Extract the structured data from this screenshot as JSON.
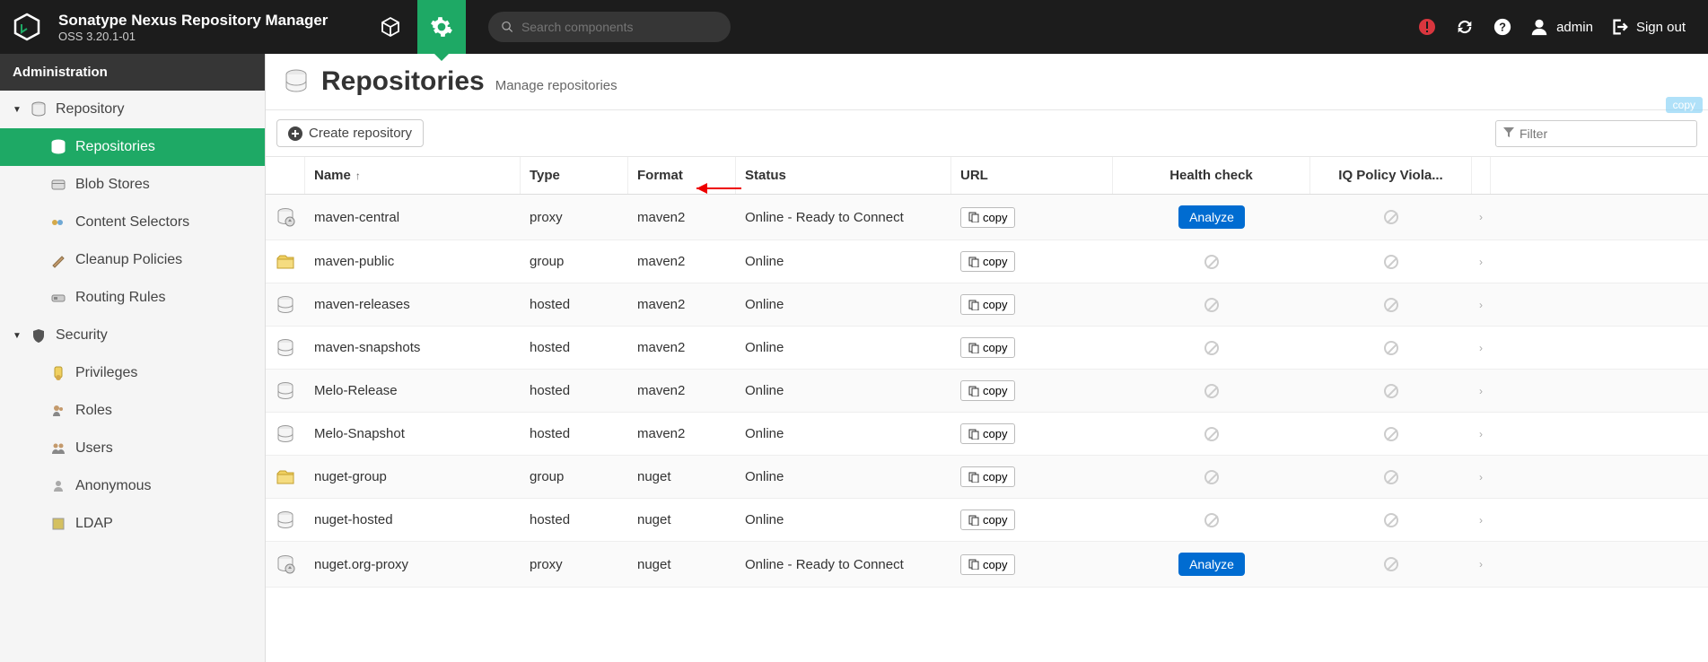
{
  "header": {
    "title": "Sonatype Nexus Repository Manager",
    "version": "OSS 3.20.1-01",
    "search_placeholder": "Search components",
    "username": "admin",
    "signout": "Sign out"
  },
  "sidebar": {
    "title": "Administration",
    "sections": [
      {
        "label": "Repository",
        "expanded": true,
        "items": [
          {
            "label": "Repositories",
            "icon": "db",
            "active": true
          },
          {
            "label": "Blob Stores",
            "icon": "blob"
          },
          {
            "label": "Content Selectors",
            "icon": "tag"
          },
          {
            "label": "Cleanup Policies",
            "icon": "brush"
          },
          {
            "label": "Routing Rules",
            "icon": "route"
          }
        ]
      },
      {
        "label": "Security",
        "expanded": true,
        "items": [
          {
            "label": "Privileges",
            "icon": "badge"
          },
          {
            "label": "Roles",
            "icon": "roles"
          },
          {
            "label": "Users",
            "icon": "users"
          },
          {
            "label": "Anonymous",
            "icon": "anon"
          },
          {
            "label": "LDAP",
            "icon": "ldap"
          }
        ]
      }
    ]
  },
  "page": {
    "title": "Repositories",
    "subtitle": "Manage repositories",
    "create_btn": "Create repository",
    "filter_placeholder": "Filter",
    "copy_badge": "copy",
    "columns": {
      "name": "Name",
      "type": "Type",
      "format": "Format",
      "status": "Status",
      "url": "URL",
      "health": "Health check",
      "policy": "IQ Policy Viola..."
    },
    "copy_label": "copy",
    "analyze_label": "Analyze",
    "rows": [
      {
        "name": "maven-central",
        "type": "proxy",
        "format": "maven2",
        "status": "Online - Ready to Connect",
        "icon": "proxy",
        "health": "analyze"
      },
      {
        "name": "maven-public",
        "type": "group",
        "format": "maven2",
        "status": "Online",
        "icon": "group",
        "health": "na"
      },
      {
        "name": "maven-releases",
        "type": "hosted",
        "format": "maven2",
        "status": "Online",
        "icon": "hosted",
        "health": "na"
      },
      {
        "name": "maven-snapshots",
        "type": "hosted",
        "format": "maven2",
        "status": "Online",
        "icon": "hosted",
        "health": "na"
      },
      {
        "name": "Melo-Release",
        "type": "hosted",
        "format": "maven2",
        "status": "Online",
        "icon": "hosted",
        "health": "na"
      },
      {
        "name": "Melo-Snapshot",
        "type": "hosted",
        "format": "maven2",
        "status": "Online",
        "icon": "hosted",
        "health": "na"
      },
      {
        "name": "nuget-group",
        "type": "group",
        "format": "nuget",
        "status": "Online",
        "icon": "group",
        "health": "na"
      },
      {
        "name": "nuget-hosted",
        "type": "hosted",
        "format": "nuget",
        "status": "Online",
        "icon": "hosted",
        "health": "na"
      },
      {
        "name": "nuget.org-proxy",
        "type": "proxy",
        "format": "nuget",
        "status": "Online - Ready to Connect",
        "icon": "proxy",
        "health": "analyze"
      }
    ]
  }
}
